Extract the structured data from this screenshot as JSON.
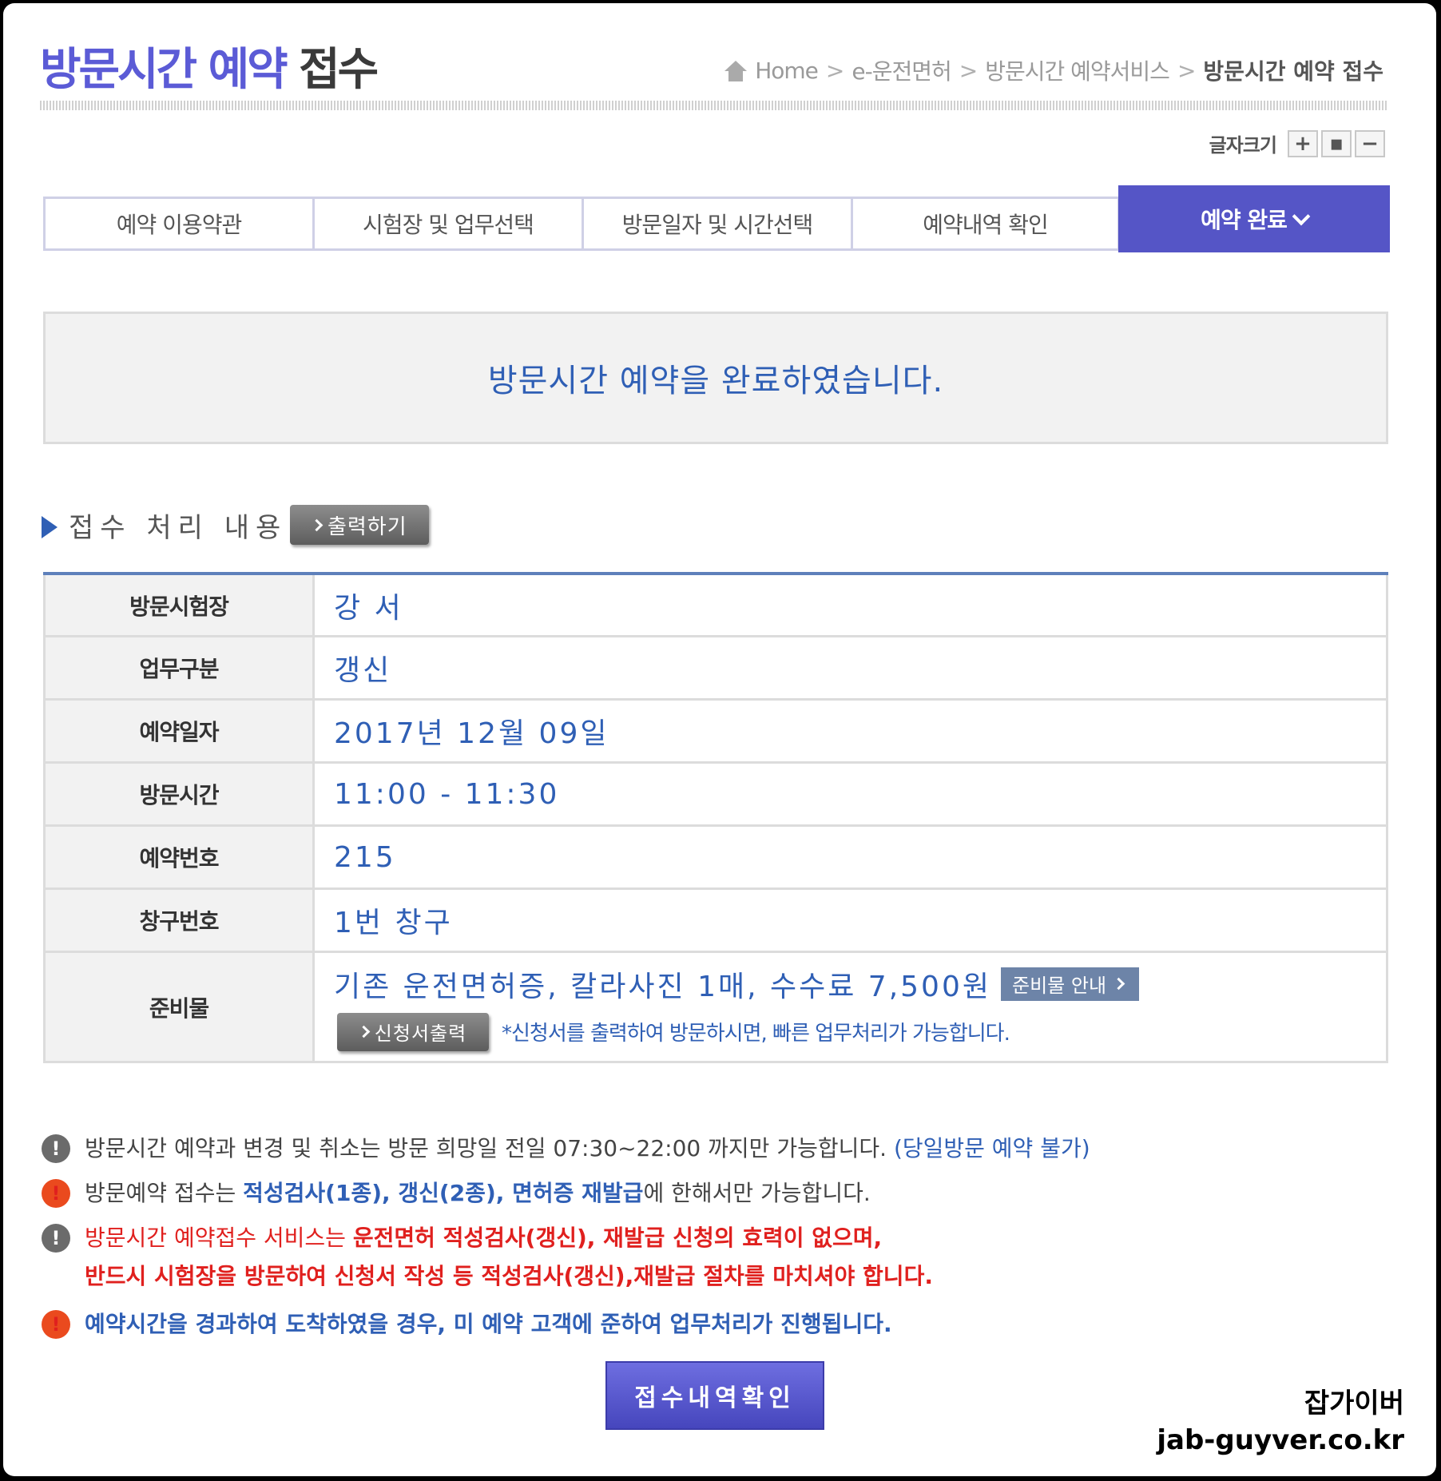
{
  "header": {
    "title_accent": "방문시간 예약",
    "title_rest": "접수",
    "breadcrumb": {
      "home": "Home",
      "items": [
        "e-운전면허",
        "방문시간 예약서비스"
      ],
      "current": "방문시간 예약 접수",
      "separator": ">"
    },
    "font_size": {
      "label": "글자크기",
      "plus": "+",
      "reset": "▪",
      "minus": "−"
    }
  },
  "steps": [
    {
      "label": "예약 이용약관"
    },
    {
      "label": "시험장 및 업무선택"
    },
    {
      "label": "방문일자 및 시간선택"
    },
    {
      "label": "예약내역 확인"
    },
    {
      "label": "예약 완료"
    }
  ],
  "message": "방문시간 예약을 완료하였습니다.",
  "section": {
    "title": "접수 처리 내용",
    "print_label": "출력하기"
  },
  "table": {
    "rows": [
      {
        "label": "방문시험장",
        "value": "강 서"
      },
      {
        "label": "업무구분",
        "value": "갱신"
      },
      {
        "label": "예약일자",
        "value": "2017년 12월 09일"
      },
      {
        "label": "방문시간",
        "value": "11:00 - 11:30"
      },
      {
        "label": "예약번호",
        "value": "215"
      },
      {
        "label": "창구번호",
        "value": "1번 창구"
      }
    ],
    "prep": {
      "label": "준비물",
      "value": "기존 운전면허증, 칼라사진 1매, 수수료 7,500원",
      "guide_label": "준비물 안내",
      "apply_label": "신청서출력",
      "hint": "*신청서를 출력하여 방문하시면, 빠른 업무처리가 가능합니다."
    }
  },
  "notices": {
    "n1": {
      "text": "방문시간 예약과 변경 및 취소는 방문 희망일 전일 07:30~22:00 까지만 가능합니다.",
      "extra": "(당일방문 예약 불가)"
    },
    "n2": {
      "pre": "방문예약 접수는 ",
      "bold": "적성검사(1종), 갱신(2종), 면허증 재발급",
      "post": "에 한해서만 가능합니다."
    },
    "n3": {
      "pre": "방문시간 예약접수 서비스는 ",
      "bold": "운전면허 적성검사(갱신), 재발급 신청의 효력이 없으며,",
      "line2": "반드시 시험장을 방문하여 신청서 작성 등 적성검사(갱신),재발급 절차를 마치셔야 합니다."
    },
    "n4": {
      "text": "예약시간을 경과하여 도착하였을 경우, 미 예약 고객에 준하여 업무처리가 진행됩니다."
    },
    "icon_char": "!"
  },
  "confirm_label": "접수내역확인",
  "watermark": {
    "line1": "잡가이버",
    "line2": "jab-guyver.co.kr"
  },
  "colors": {
    "accent": "#5555c6",
    "blue_text": "#2f5fb5",
    "red_text": "#e0201e",
    "table_rule": "#5e80bb"
  }
}
